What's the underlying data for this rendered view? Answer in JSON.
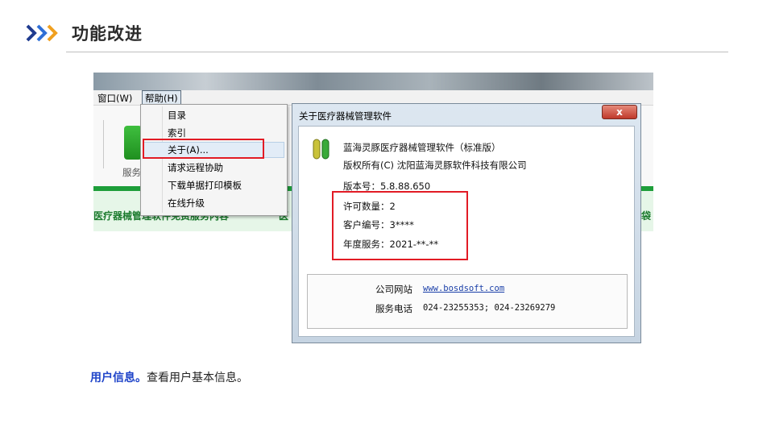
{
  "slide": {
    "title": "功能改进",
    "description_label": "用户信息。",
    "description_text": "查看用户基本信息。"
  },
  "menubar": {
    "window": "窗口(W)",
    "help": "帮助(H)"
  },
  "help_menu": {
    "items": [
      "目录",
      "索引",
      "关于(A)...",
      "请求远程协助",
      "下载单据打印模板",
      "在线升级"
    ]
  },
  "toolbar": {
    "service_label": "服务"
  },
  "notice": {
    "text": "医疗器械管理软件免费服务内容",
    "text2": "医",
    "right": "袋"
  },
  "about_dialog": {
    "title": "关于医疗器械管理软件",
    "close": "x",
    "product": "蓝海灵豚医疗器械管理软件（标准版）",
    "copyright": "版权所有(C) 沈阳蓝海灵豚软件科技有限公司",
    "version": "版本号：5.8.88.650",
    "license": "许可数量：2",
    "customer_id": "客户编号：3****",
    "annual_service": "年度服务：2021-**-**",
    "website_label": "公司网站",
    "website": "www.bosdsoft.com",
    "phone_label": "服务电话",
    "phone": "024-23255353; 024-23269279"
  },
  "colors": {
    "accent_blue": "#1f44c9",
    "chevron_dark": "#1f3b8f",
    "chevron_light": "#f0a020",
    "highlight_red": "#e21b25",
    "green": "#1e9e3a"
  }
}
